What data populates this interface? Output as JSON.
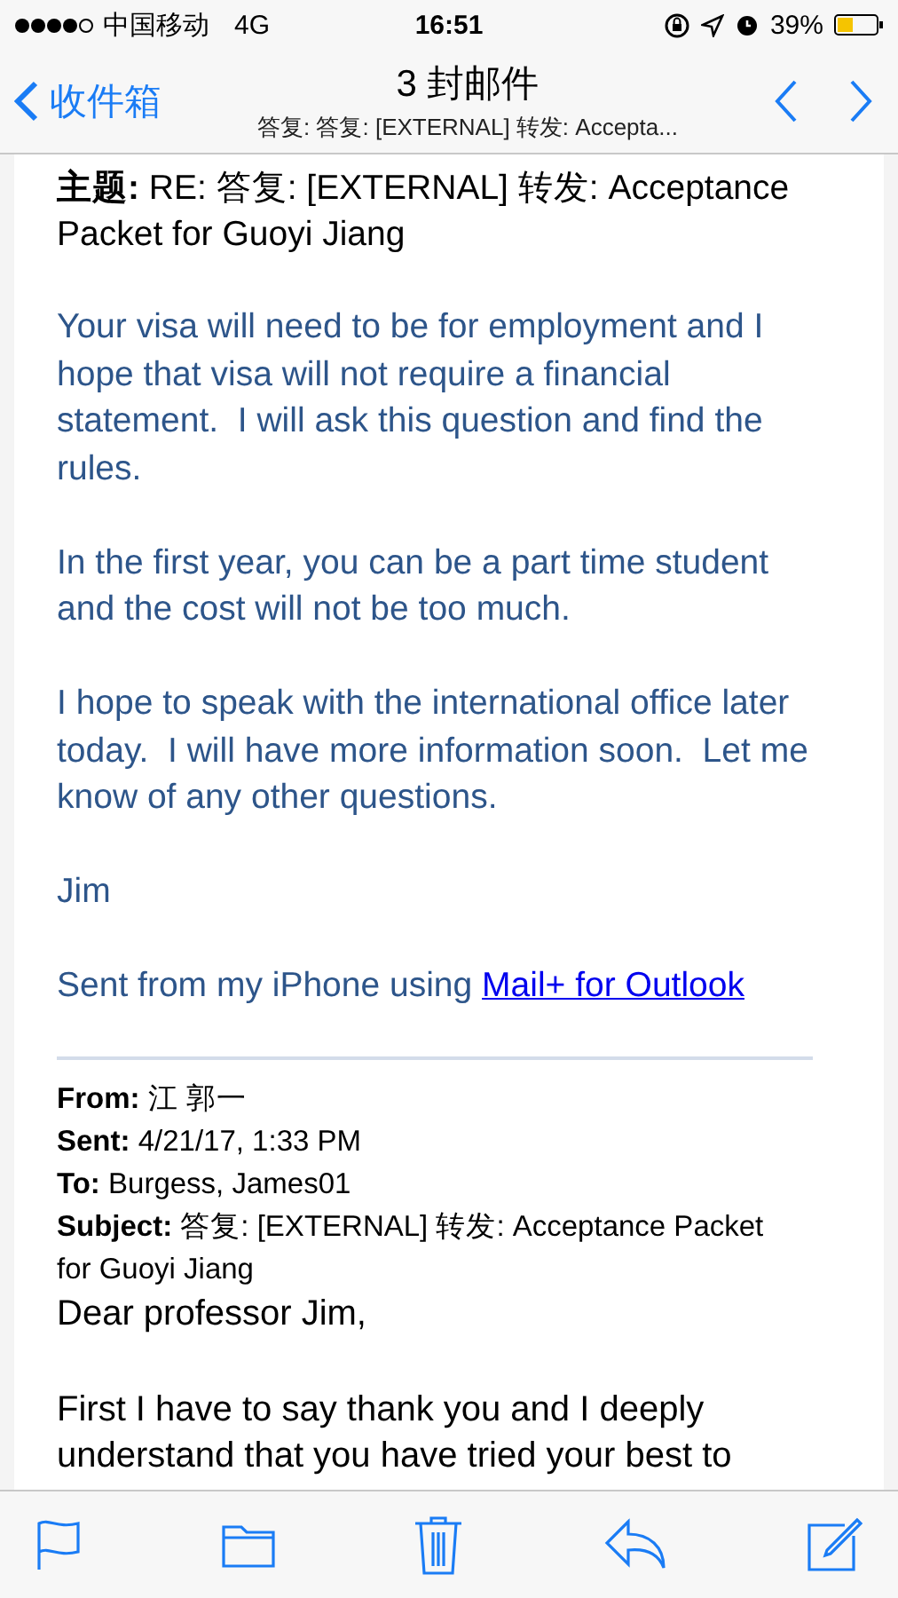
{
  "status_bar": {
    "carrier": "中国移动",
    "network": "4G",
    "time": "16:51",
    "battery": "39%"
  },
  "nav": {
    "back": "收件箱",
    "title": "3 封邮件",
    "subtitle": "答复: 答复: [EXTERNAL] 转发: Accepta..."
  },
  "message": {
    "subject_label": "主题:",
    "subject": "RE: 答复: [EXTERNAL] 转发: Acceptance Packet for Guoyi Jiang",
    "paragraphs": [
      "Your visa will need to be for employment and I hope that visa will not require a financial statement.  I will ask this question and find the rules.",
      "In the first year, you can be a part time student and the cost will not be too much.",
      "I hope to speak with the international office later today.  I will have more information soon.  Let me know of any other questions.",
      "Jim"
    ],
    "sent_from": {
      "text": "Sent from my iPhone using",
      "link": "Mail+ for Outlook"
    }
  },
  "quoted": {
    "headers": [
      "**From:** 江 郭一",
      "**Sent:** 4/21/17, 1:33 PM",
      "**To:** Burgess, James01",
      "**Subject:** 答复: [EXTERNAL] 转发: Acceptance Packet for Guoyi Jiang"
    ],
    "greeting": "Dear professor Jim,",
    "paragraphs": [
      "First I have to say thank you and I deeply understand that you have tried your best to"
    ]
  }
}
